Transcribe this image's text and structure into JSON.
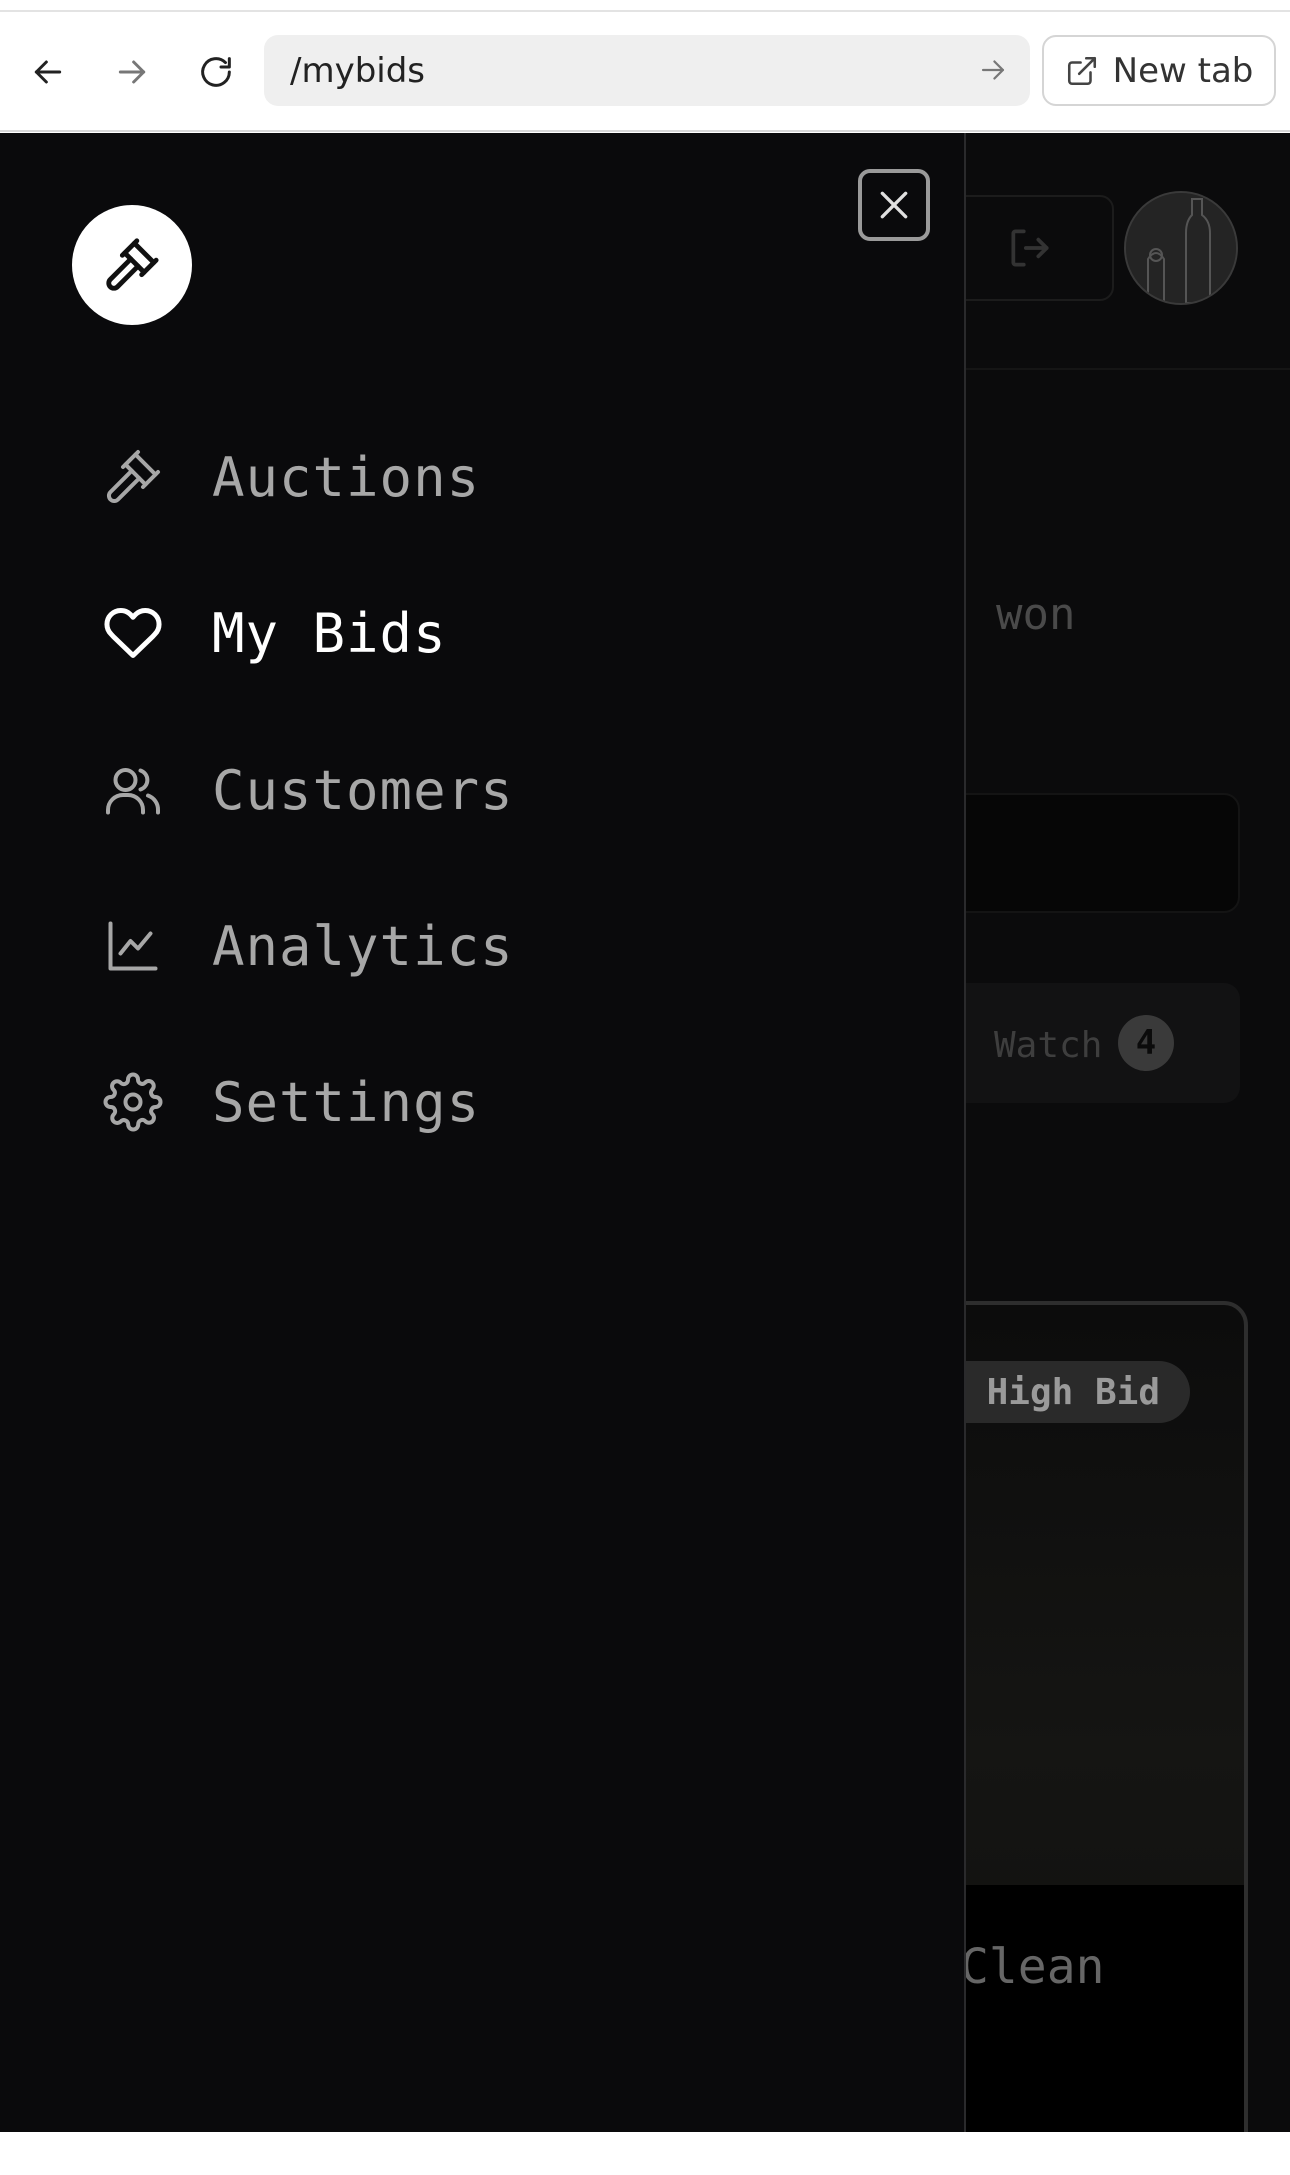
{
  "browser": {
    "url": "/mybids",
    "new_tab_label": "New tab",
    "icons": [
      "back-arrow-icon",
      "forward-arrow-icon",
      "reload-icon",
      "go-arrow-icon",
      "external-link-icon"
    ]
  },
  "drawer": {
    "logo_icon": "gavel-icon",
    "close_icon": "close-icon",
    "items": [
      {
        "label": "Auctions",
        "icon": "gavel-icon",
        "active": false
      },
      {
        "label": "My Bids",
        "icon": "heart-icon",
        "active": true
      },
      {
        "label": "Customers",
        "icon": "users-icon",
        "active": false
      },
      {
        "label": "Analytics",
        "icon": "line-chart-icon",
        "active": false
      },
      {
        "label": "Settings",
        "icon": "gear-icon",
        "active": false
      }
    ]
  },
  "background_page": {
    "won_text": "won",
    "watch_label": "Watch",
    "watch_count": "4",
    "high_bid_badge": "High Bid",
    "card_title_fragment": "Clean"
  },
  "colors": {
    "drawer_bg": "#0a0a0c",
    "active_text": "#ffffff",
    "inactive_text": "#a7a7a7"
  }
}
